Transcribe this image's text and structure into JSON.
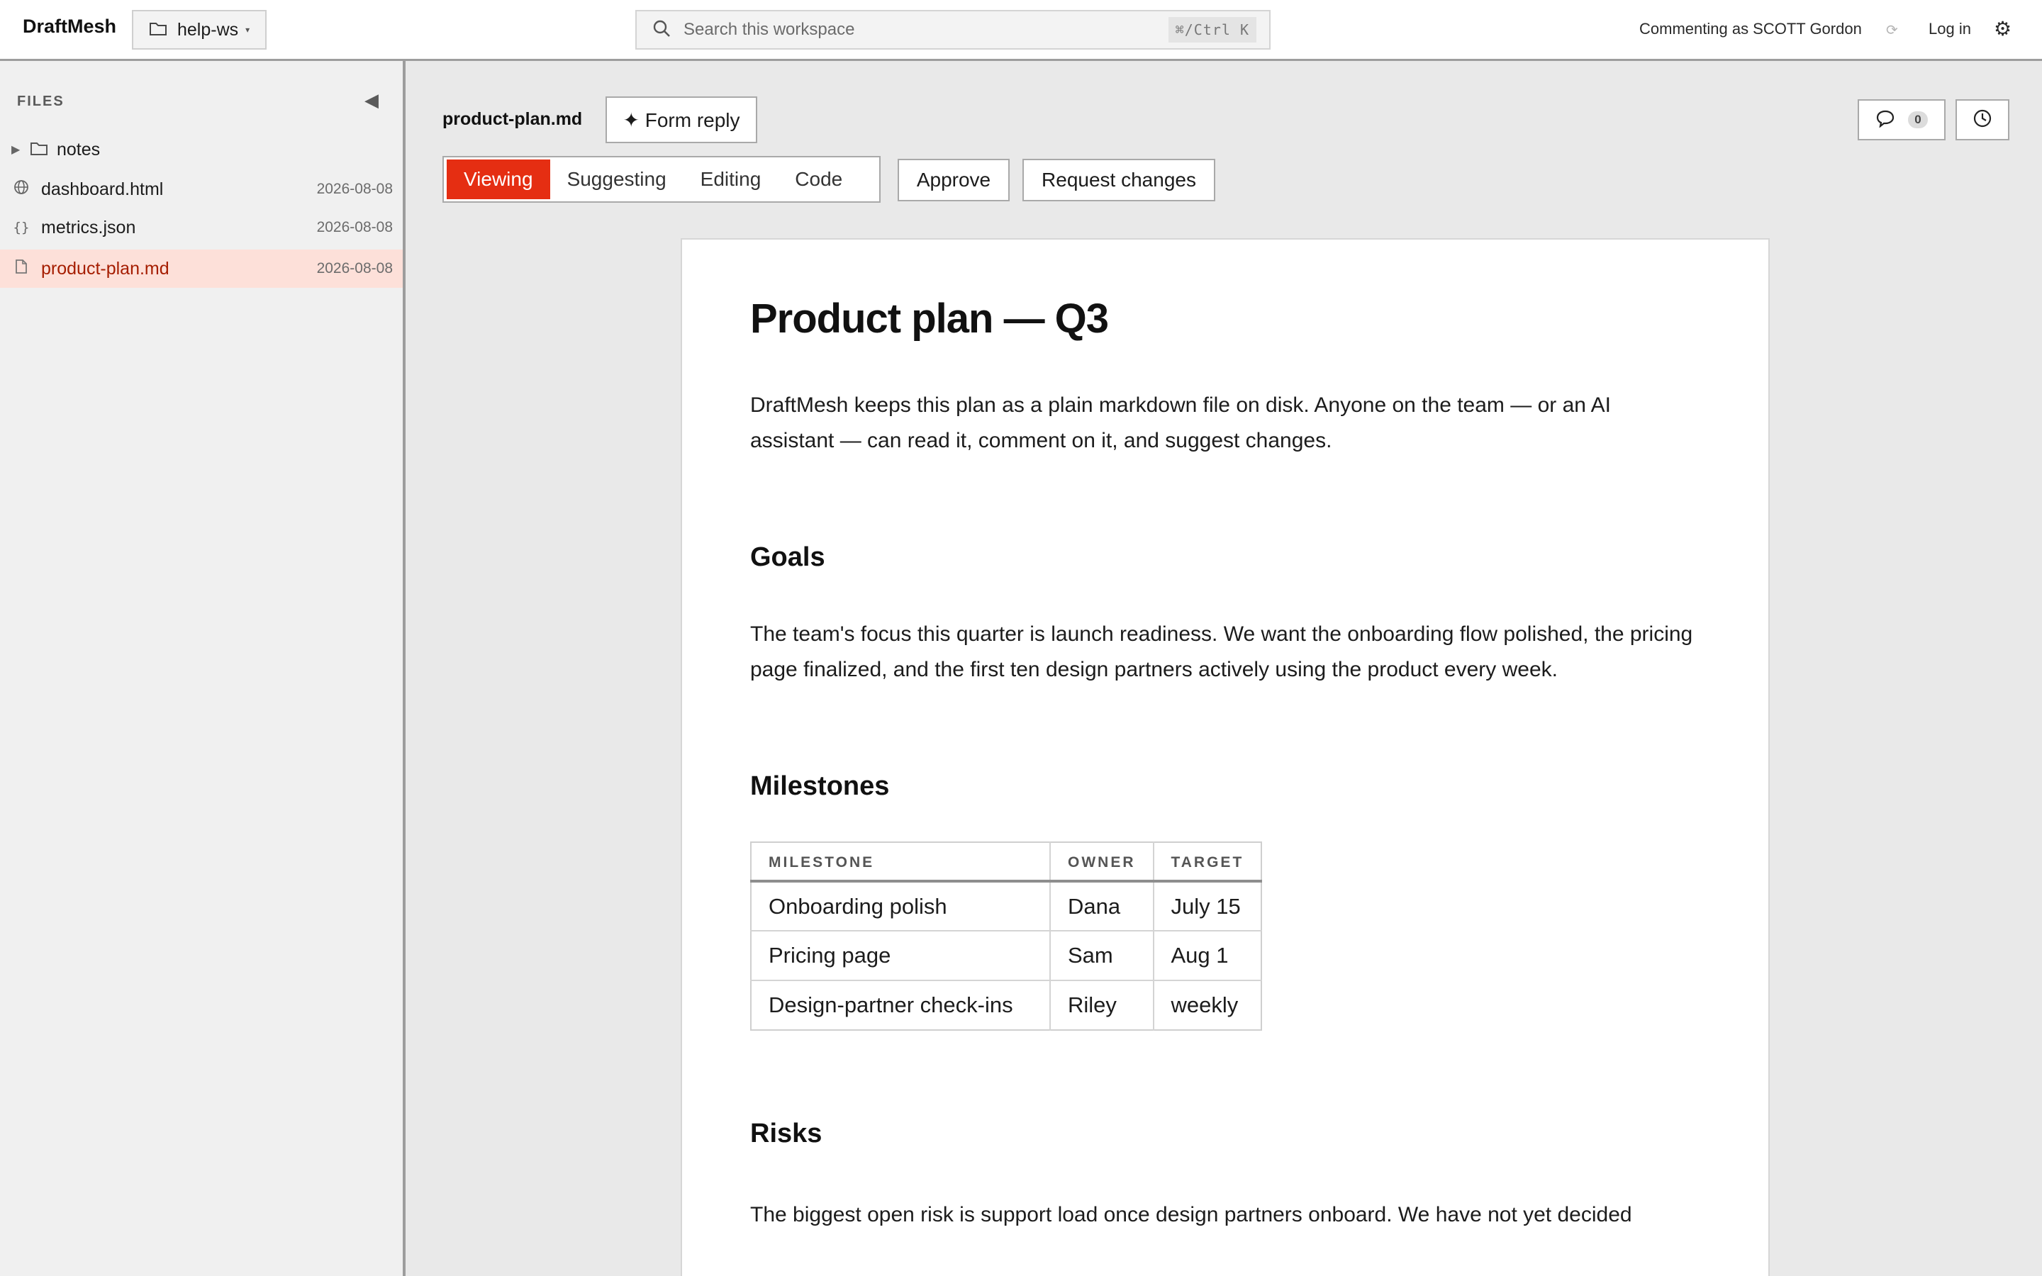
{
  "topbar": {
    "brand": "DraftMesh",
    "workspace": "help-ws",
    "search_placeholder": "Search this workspace",
    "search_shortcut": "⌘/Ctrl K",
    "commenting_as": "Commenting as SCOTT Gordon",
    "login_label": "Log in"
  },
  "sidebar": {
    "title": "FILES",
    "items": [
      {
        "name": "notes",
        "type": "folder",
        "date": ""
      },
      {
        "name": "dashboard.html",
        "type": "globe",
        "date": "2026-08-08"
      },
      {
        "name": "metrics.json",
        "type": "json",
        "date": "2026-08-08"
      },
      {
        "name": "product-plan.md",
        "type": "file",
        "date": "2026-08-08",
        "active": true
      }
    ]
  },
  "toolbar": {
    "file_title": "product-plan.md",
    "form_reply_label": "✦ Form reply",
    "modes": [
      "Viewing",
      "Suggesting",
      "Editing",
      "Code"
    ],
    "active_mode": "Viewing",
    "approve_label": "Approve",
    "request_changes_label": "Request changes",
    "comment_count": "0"
  },
  "document": {
    "title": "Product plan — Q3",
    "intro": "DraftMesh keeps this plan as a plain markdown file on disk. Anyone on the team — or an AI assistant — can read it, comment on it, and suggest changes.",
    "goals_heading": "Goals",
    "goals_text": "The team's focus this quarter is launch readiness. We want the onboarding flow polished, the pricing page finalized, and the first ten design partners actively using the product every week.",
    "milestones_heading": "Milestones",
    "table": {
      "headers": [
        "MILESTONE",
        "OWNER",
        "TARGET"
      ],
      "rows": [
        [
          "Onboarding polish",
          "Dana",
          "July 15"
        ],
        [
          "Pricing page",
          "Sam",
          "Aug 1"
        ],
        [
          "Design-partner check-ins",
          "Riley",
          "weekly"
        ]
      ]
    },
    "risks_heading": "Risks",
    "risks_text": "The biggest open risk is support load once design partners onboard. We have not yet decided"
  },
  "colors": {
    "accent": "#e52e12",
    "active_row_bg": "#fde0d9",
    "active_row_text": "#a51d00"
  }
}
